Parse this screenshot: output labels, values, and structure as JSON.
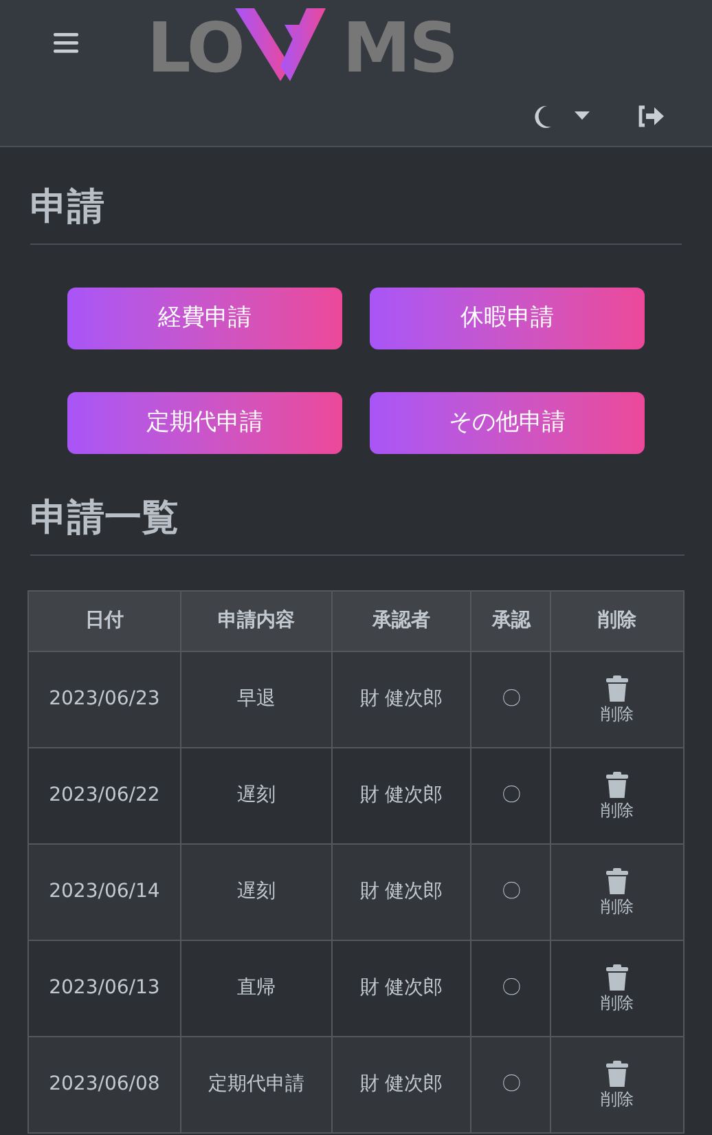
{
  "header": {
    "logo": {
      "left": "LO",
      "right": "MS"
    }
  },
  "section_apply": {
    "title": "申請",
    "buttons": [
      "経費申請",
      "休暇申請",
      "定期代申請",
      "その他申請"
    ]
  },
  "section_list": {
    "title": "申請一覧",
    "table": {
      "columns": [
        "日付",
        "申請内容",
        "承認者",
        "承認",
        "削除"
      ],
      "rows": [
        {
          "date": "2023/06/23",
          "content": "早退",
          "approver": "財 健次郎",
          "approval": "〇",
          "delete": "削除"
        },
        {
          "date": "2023/06/22",
          "content": "遅刻",
          "approver": "財 健次郎",
          "approval": "〇",
          "delete": "削除"
        },
        {
          "date": "2023/06/14",
          "content": "遅刻",
          "approver": "財 健次郎",
          "approval": "〇",
          "delete": "削除"
        },
        {
          "date": "2023/06/13",
          "content": "直帰",
          "approver": "財 健次郎",
          "approval": "〇",
          "delete": "削除"
        },
        {
          "date": "2023/06/08",
          "content": "定期代申請",
          "approver": "財 健次郎",
          "approval": "〇",
          "delete": "削除"
        }
      ]
    }
  }
}
